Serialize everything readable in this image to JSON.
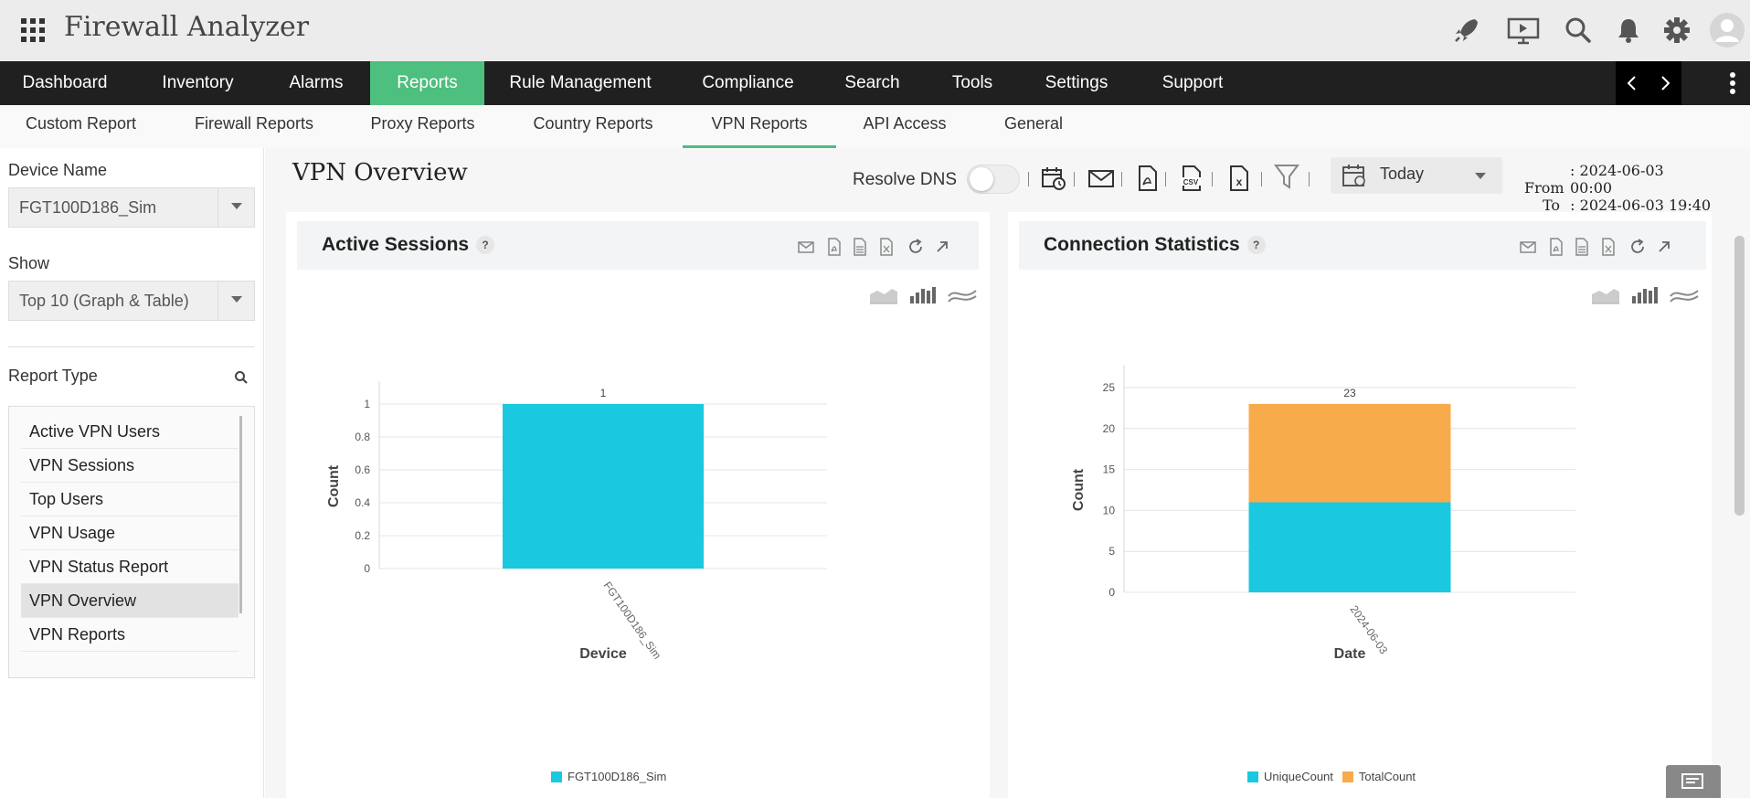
{
  "app": {
    "title": "Firewall Analyzer"
  },
  "main_nav": {
    "items": [
      "Dashboard",
      "Inventory",
      "Alarms",
      "Reports",
      "Rule Management",
      "Compliance",
      "Search",
      "Tools",
      "Settings",
      "Support"
    ],
    "active": "Reports"
  },
  "sub_nav": {
    "items": [
      "Custom Report",
      "Firewall Reports",
      "Proxy Reports",
      "Country Reports",
      "VPN Reports",
      "API Access",
      "General"
    ],
    "active": "VPN Reports"
  },
  "left_panel": {
    "device_label": "Device Name",
    "device_value": "FGT100D186_Sim",
    "show_label": "Show",
    "show_value": "Top 10 (Graph & Table)",
    "report_type_label": "Report Type",
    "reports": [
      "Active VPN Users",
      "VPN Sessions",
      "Top Users",
      "VPN Usage",
      "VPN Status Report",
      "VPN Overview",
      "VPN Reports"
    ],
    "active_report": "VPN Overview"
  },
  "toolbar": {
    "page_title": "VPN Overview",
    "resolve_dns_label": "Resolve DNS",
    "resolve_dns_on": false,
    "period": "Today",
    "from_label": "From",
    "from_value": ": 2024-06-03 00:00",
    "to_label": "To",
    "to_value": ": 2024-06-03 19:40"
  },
  "panels": {
    "active_sessions": {
      "title": "Active Sessions",
      "help": "?"
    },
    "connection_statistics": {
      "title": "Connection Statistics",
      "help": "?"
    }
  },
  "colors": {
    "nav_active": "#4dbf7e",
    "unique": "#1ac8e0",
    "total": "#f8ab4b",
    "nav_bg": "#202020"
  },
  "chart_data": [
    {
      "type": "bar",
      "title": "Active Sessions",
      "xlabel": "Device",
      "ylabel": "Count",
      "categories": [
        "FGT100D186_Sim"
      ],
      "series": [
        {
          "name": "FGT100D186_Sim",
          "values": [
            1
          ]
        }
      ],
      "data_labels": [
        "1"
      ],
      "yticks": [
        "0",
        "0.2",
        "0.4",
        "0.6",
        "0.8",
        "1"
      ],
      "ylim": [
        0,
        1
      ],
      "grid": true,
      "legend": "bottom"
    },
    {
      "type": "bar",
      "stacked": true,
      "title": "Connection Statistics",
      "xlabel": "Date",
      "ylabel": "Count",
      "categories": [
        "2024-06-03"
      ],
      "series": [
        {
          "name": "UniqueCount",
          "values": [
            11
          ]
        },
        {
          "name": "TotalCount",
          "values": [
            12
          ]
        }
      ],
      "data_labels": [
        "23"
      ],
      "yticks": [
        "0",
        "5",
        "10",
        "15",
        "20",
        "25"
      ],
      "ylim": [
        0,
        25
      ],
      "grid": true,
      "legend": "bottom"
    }
  ]
}
